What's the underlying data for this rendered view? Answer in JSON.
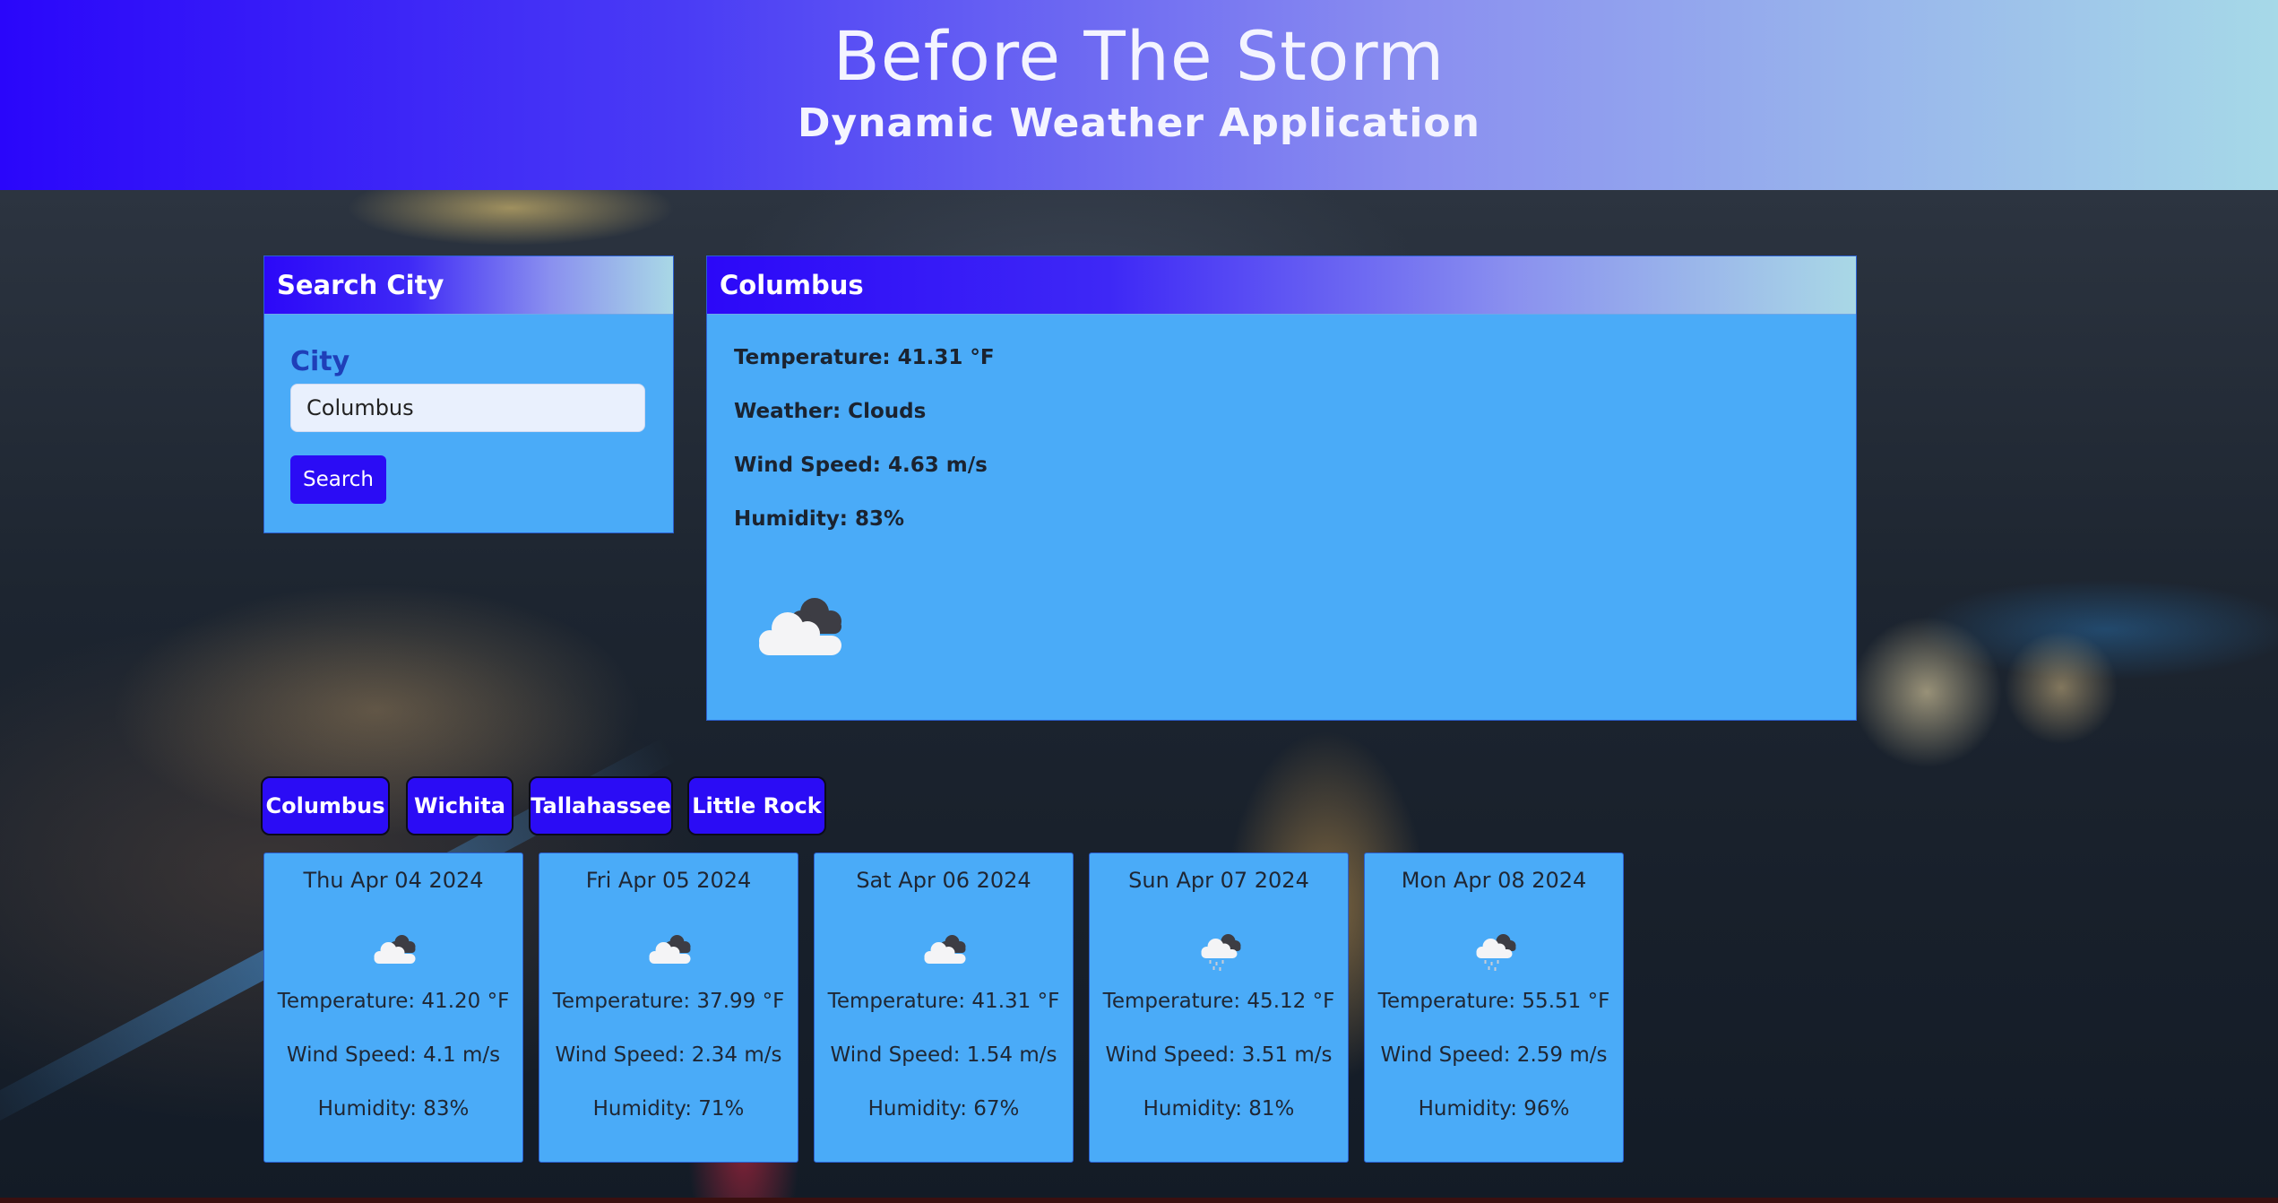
{
  "header": {
    "title": "Before The Storm",
    "subtitle": "Dynamic Weather Application"
  },
  "search": {
    "panel_title": "Search City",
    "city_label": "City",
    "input_value": "Columbus",
    "button_label": "Search"
  },
  "current": {
    "city": "Columbus",
    "temperature": "Temperature: 41.31 °F",
    "weather": "Weather: Clouds",
    "wind": "Wind Speed: 4.63 m/s",
    "humidity": "Humidity: 83%",
    "icon": "cloudy-icon"
  },
  "history": [
    "Columbus",
    "Wichita",
    "Tallahassee",
    "Little Rock"
  ],
  "forecast": [
    {
      "date": "Thu Apr 04 2024",
      "icon": "cloudy-icon",
      "temp": "Temperature: 41.20 °F",
      "wind": "Wind Speed: 4.1 m/s",
      "humidity": "Humidity: 83%"
    },
    {
      "date": "Fri Apr 05 2024",
      "icon": "cloudy-icon",
      "temp": "Temperature: 37.99 °F",
      "wind": "Wind Speed: 2.34 m/s",
      "humidity": "Humidity: 71%"
    },
    {
      "date": "Sat Apr 06 2024",
      "icon": "cloudy-icon",
      "temp": "Temperature: 41.31 °F",
      "wind": "Wind Speed: 1.54 m/s",
      "humidity": "Humidity: 67%"
    },
    {
      "date": "Sun Apr 07 2024",
      "icon": "rain-icon",
      "temp": "Temperature: 45.12 °F",
      "wind": "Wind Speed: 3.51 m/s",
      "humidity": "Humidity: 81%"
    },
    {
      "date": "Mon Apr 08 2024",
      "icon": "rain-icon",
      "temp": "Temperature: 55.51 °F",
      "wind": "Wind Speed: 2.59 m/s",
      "humidity": "Humidity: 96%"
    }
  ],
  "colors": {
    "accent": "#2b0cf5",
    "panel": "#4aabf8",
    "label": "#1f3fb8"
  }
}
